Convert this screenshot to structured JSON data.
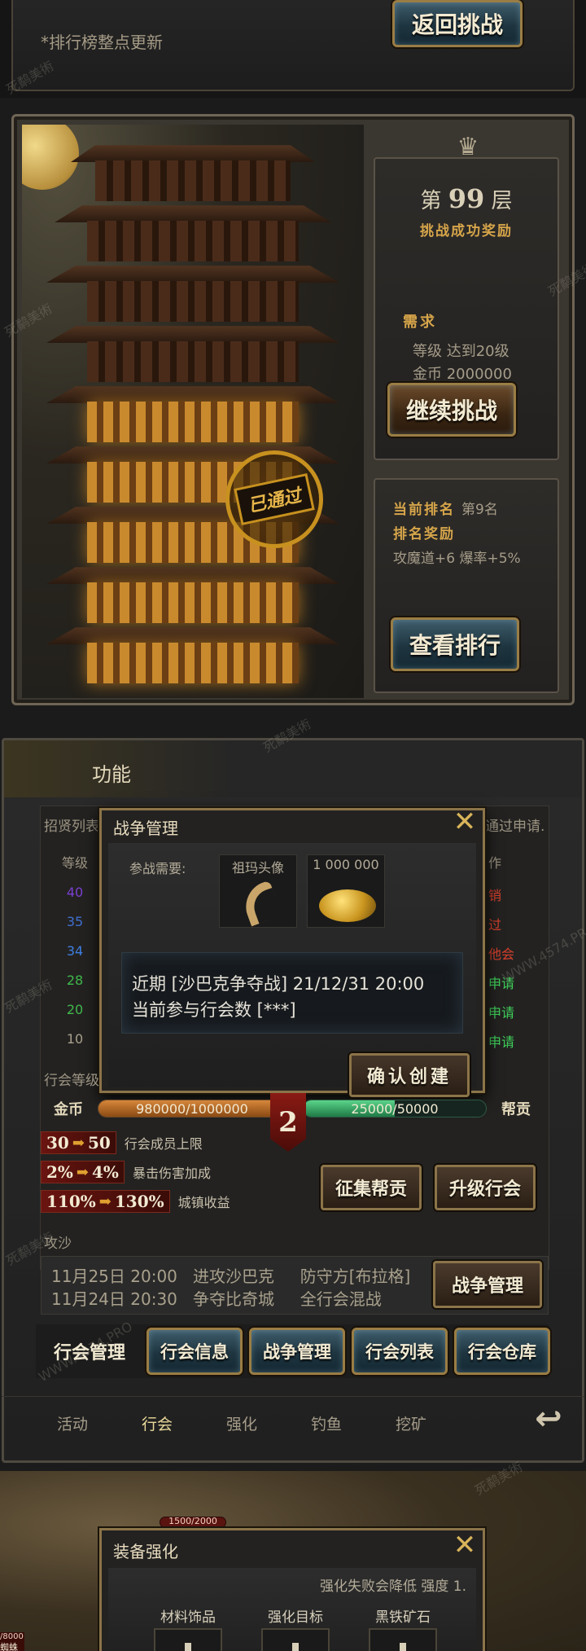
{
  "top": {
    "rank_note": "*排行榜整点更新",
    "back_button": "返回挑战"
  },
  "tower": {
    "stamp": "已通过",
    "floor_prefix": "第",
    "floor_number": "99",
    "floor_suffix": "层",
    "reward_title": "挑战成功奖励",
    "requirement_title": "需求",
    "requirements": [
      {
        "label": "等级",
        "value": "达到20级"
      },
      {
        "label": "金币",
        "value": "2000000"
      }
    ],
    "continue_button": "继续挑战",
    "rank_label": "当前排名",
    "rank_value": "第9名",
    "rank_reward_label": "排名奖励",
    "rank_reward_value": "攻魔道+6  爆率+5%",
    "view_rank_button": "查看排行"
  },
  "guild": {
    "title": "功能",
    "recruit_list_title": "招贤列表",
    "pending_title": "通过申请.",
    "level_header": "等级",
    "action_header": "作",
    "levels": [
      {
        "value": "40",
        "color": "#7a3fd0"
      },
      {
        "value": "35",
        "color": "#3f6fd0"
      },
      {
        "value": "34",
        "color": "#3f7fe0"
      },
      {
        "value": "28",
        "color": "#3fb84a"
      },
      {
        "value": "20",
        "color": "#3fb84a"
      },
      {
        "value": "10",
        "color": "#a8a08c"
      }
    ],
    "actions": [
      {
        "text": "销",
        "color": "#d8402c"
      },
      {
        "text": "过",
        "color": "#d8402c"
      },
      {
        "text": "他会",
        "color": "#d8402c"
      },
      {
        "text": "申请",
        "color": "#3fd05a"
      },
      {
        "text": "申请",
        "color": "#3fd05a"
      },
      {
        "text": "申请",
        "color": "#3fd05a"
      }
    ],
    "level_label": "行会等级",
    "gold_label": "金币",
    "gold_text": "980000/1000000",
    "gold_progress": 0.98,
    "guild_level": "2",
    "contrib_text": "25000/50000",
    "contrib_progress": 0.5,
    "contrib_label": "帮贡",
    "perks": [
      {
        "from": "30",
        "to": "50",
        "text": "行会成员上限"
      },
      {
        "from": "2%",
        "to": "4%",
        "text": "暴击伤害加成"
      },
      {
        "from": "110%",
        "to": "130%",
        "text": "城镇收益"
      }
    ],
    "perk_arrow": "➡",
    "collect_button": "征集帮贡",
    "upgrade_button": "升级行会",
    "siege_title": "攻沙",
    "siege_lines": [
      "11月25日 20:00   进攻沙巴克     防守方[布拉格]",
      "11月24日 20:30   争夺比奇城     全行会混战"
    ],
    "war_button": "战争管理",
    "tabs": {
      "manage": "行会管理",
      "info": "行会信息",
      "war": "战争管理",
      "list": "行会列表",
      "warehouse": "行会仓库"
    },
    "nav": [
      "活动",
      "行会",
      "强化",
      "钓鱼",
      "挖矿"
    ],
    "nav_active": 1
  },
  "war_modal": {
    "title": "战争管理",
    "requirement_label": "参战需要:",
    "item1_label": "祖玛头像",
    "item2_label": "1 000 000",
    "recent_line": "近期 [沙巴克争夺战] 21/12/31 20:00",
    "count_line": "当前参与行会数 [***]",
    "confirm_button": "确认创建"
  },
  "equip": {
    "hp_text": "1500/2000",
    "title": "装备强化",
    "fail_note": "强化失败会降低 强度 1.",
    "columns": [
      "材料饰品",
      "强化目标",
      "黑铁矿石"
    ],
    "side_hp": "/8000",
    "side_name": "蜘蛛"
  },
  "watermarks": [
    "死鹬美術",
    "WWW.4574.PRO"
  ]
}
